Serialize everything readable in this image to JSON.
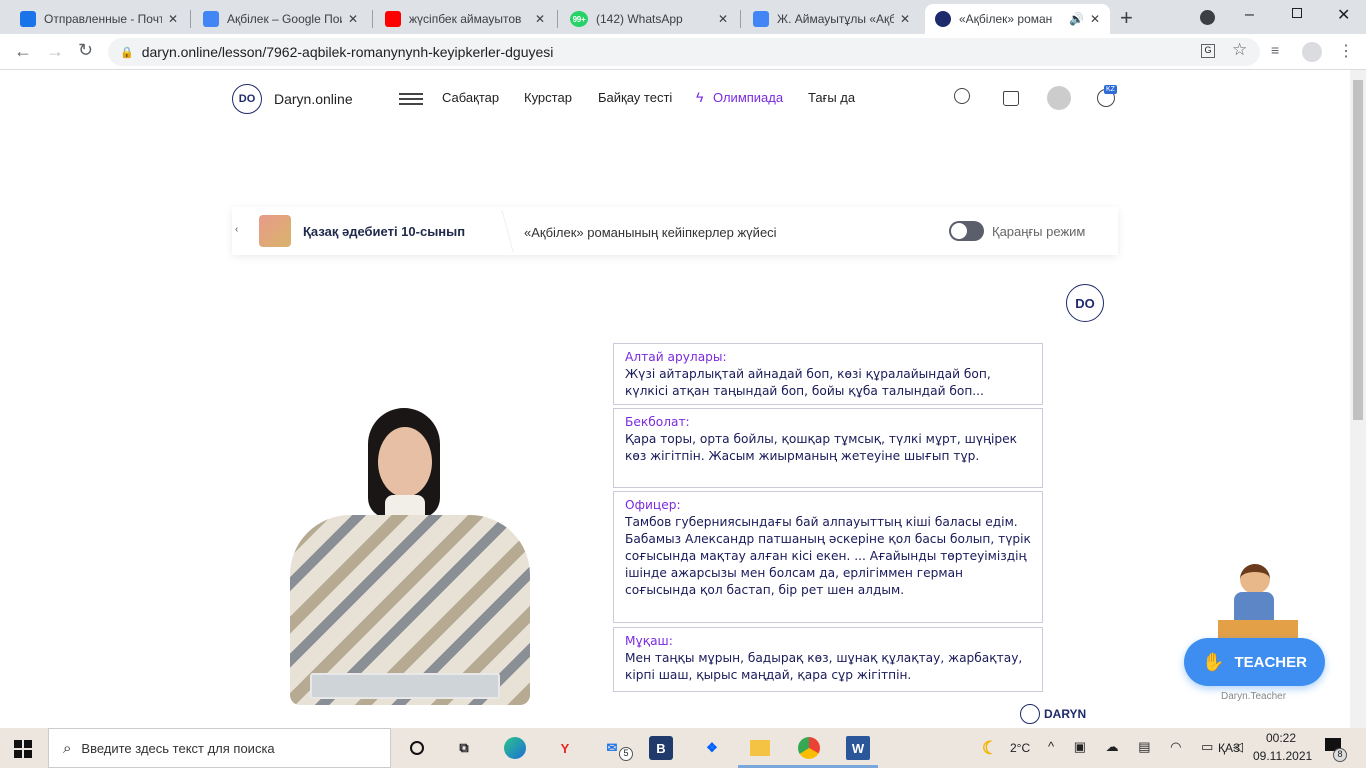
{
  "browser": {
    "tabs": [
      {
        "title": "Отправленные - Почт",
        "icon": "mail-icon",
        "color": "#1a73e8"
      },
      {
        "title": "Ақбілек – Google Пои",
        "icon": "google-icon",
        "color": "#4285f4"
      },
      {
        "title": "жүсіпбек аймауытов",
        "icon": "youtube-icon",
        "color": "#ff0000"
      },
      {
        "title": "(142) WhatsApp",
        "icon": "whatsapp-icon",
        "color": "#25d366"
      },
      {
        "title": "Ж. Аймауытұлы «Ақбі",
        "icon": "google-icon",
        "color": "#4285f4"
      },
      {
        "title": "«Ақбілек» роман",
        "icon": "daryn-icon",
        "color": "#1f2a6b",
        "active": true
      }
    ],
    "url": "daryn.online/lesson/7962-aqbilek-romanynynh-keyipkerler-dguyesi",
    "whatsapp_badge": "99+"
  },
  "site": {
    "logo_badge": "DO",
    "logo_text": "Daryn.online",
    "nav": [
      "Сабақтар",
      "Курстар",
      "Байқау тесті",
      "Олимпиада",
      "Тағы да"
    ],
    "lang": "KZ",
    "accent": "#7a2be0"
  },
  "lesson": {
    "course": "Қазақ әдебиеті 10-сынып",
    "title": "«Ақбілек» романының кейіпкерлер жүйесі",
    "dark_mode_label": "Қараңғы режим",
    "dark_mode_on": false
  },
  "video": {
    "watermark": "DO",
    "cards": [
      {
        "name": "Алтай арулары:",
        "text": "Жүзі айтарлықтай айнадай боп, көзі құралайындай боп, күлкісі атқан таңындай боп, бойы құба талындай боп..."
      },
      {
        "name": "Бекболат:",
        "text": "Қара торы, орта бойлы, қошқар тұмсық, түлкі мұрт, шүңірек көз жігітпін. Жасым жиырманың жетеуіне шығып тұр."
      },
      {
        "name": "Офицер:",
        "text": "Тамбов губерниясындағы бай алпауыттың кіші баласы едім. Бабамыз Александр патшаның әскеріне қол басы болып, түрік соғысында мақтау алған кісі екен. ... Ағайынды төртеуіміздің ішінде ажарсызы мен болсам да, ерлігіммен герман соғысында қол бастап, бір рет шен алдым."
      },
      {
        "name": "Мұқаш:",
        "text": "Мен таңқы мұрын, бадырақ көз, шұнақ құлақтау, жарбақтау, кірпі шаш, қырыс маңдай, қара сұр жігітпін."
      }
    ],
    "footer_logo": "DARYN"
  },
  "teacher": {
    "button": "TEACHER",
    "caption": "Daryn.Teacher",
    "color": "#3d8ef0"
  },
  "taskbar": {
    "search_placeholder": "Введите здесь текст для поиска",
    "mail_badge": "5",
    "weather": "2°C",
    "lang": "ҚАЗ",
    "time": "00:22",
    "date": "09.11.2021",
    "notifications": "8"
  }
}
